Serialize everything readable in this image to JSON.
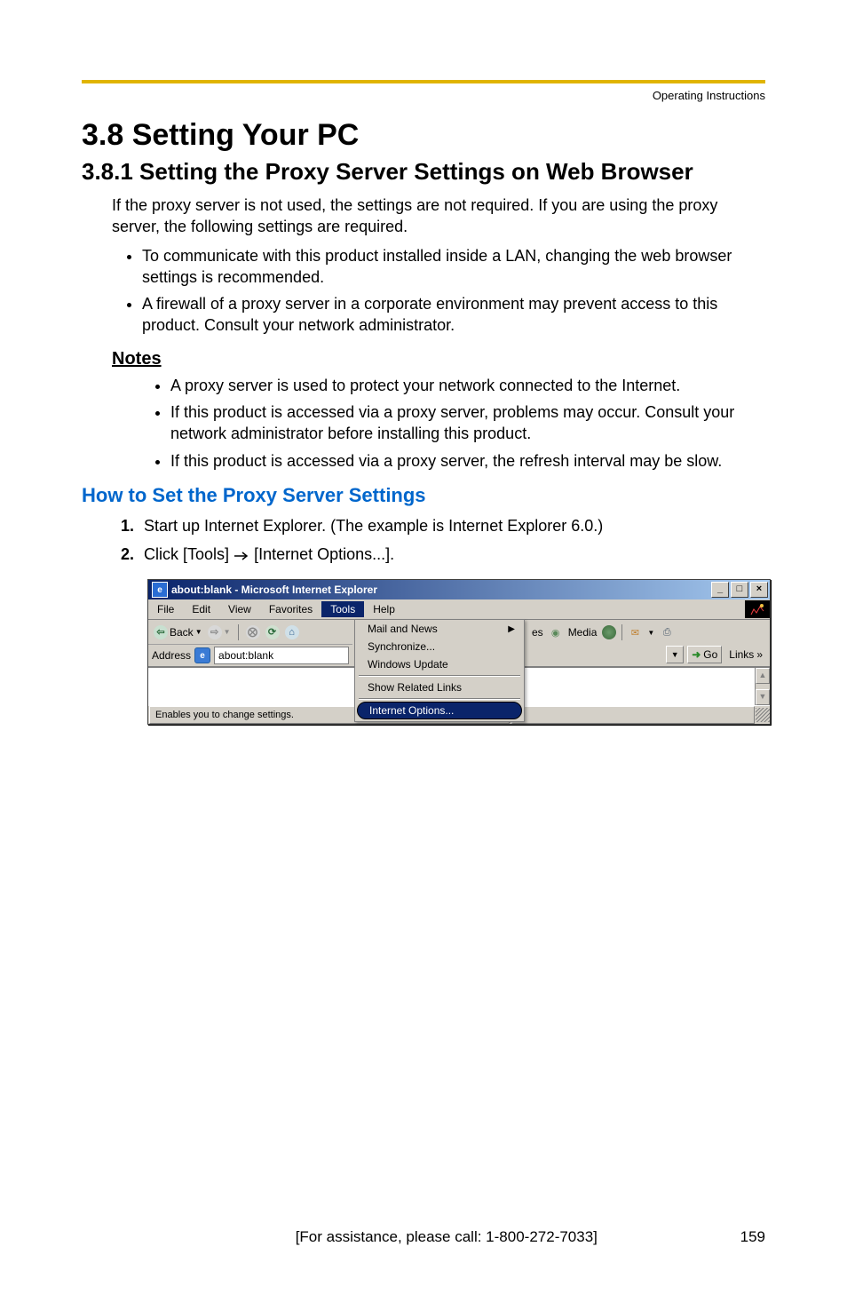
{
  "running_head": "Operating Instructions",
  "section": {
    "number_title": "3.8    Setting Your PC",
    "sub_number_title": "3.8.1    Setting the Proxy Server Settings on Web Browser"
  },
  "intro": "If the proxy server is not used, the settings are not required. If you are using the proxy server, the following settings are required.",
  "intro_bullets": [
    "To communicate with this product installed inside a LAN, changing the web browser settings is recommended.",
    "A firewall of a proxy server in a corporate environment may prevent access to this product. Consult your network administrator."
  ],
  "notes_heading": "Notes",
  "notes_bullets": [
    "A proxy server is used to protect your network connected to the Internet.",
    "If this product is accessed via a proxy server, problems may occur. Consult your network administrator before installing this product.",
    "If this product is accessed via a proxy server, the refresh interval may be slow."
  ],
  "howto_heading": "How to Set the Proxy Server Settings",
  "steps": {
    "s1": "Start up Internet Explorer. (The example is Internet Explorer 6.0.)",
    "s2_pre": "Click [Tools]",
    "s2_post": "[Internet Options...]."
  },
  "ie": {
    "title": "about:blank - Microsoft Internet Explorer",
    "menus": {
      "file": "File",
      "edit": "Edit",
      "view": "View",
      "favorites": "Favorites",
      "tools": "Tools",
      "help": "Help"
    },
    "toolbar": {
      "back": "Back"
    },
    "address": {
      "label": "Address",
      "value": "about:blank"
    },
    "dropdown": {
      "mail": "Mail and News",
      "sync": "Synchronize...",
      "wu": "Windows Update",
      "related": "Show Related Links",
      "inetopt": "Internet Options..."
    },
    "right": {
      "es": "es",
      "media": "Media",
      "go": "Go",
      "links": "Links",
      "links_chevron": "»"
    },
    "status": "Enables you to change settings."
  },
  "footer": {
    "center": "[For assistance, please call: 1-800-272-7033]",
    "right": "159"
  }
}
